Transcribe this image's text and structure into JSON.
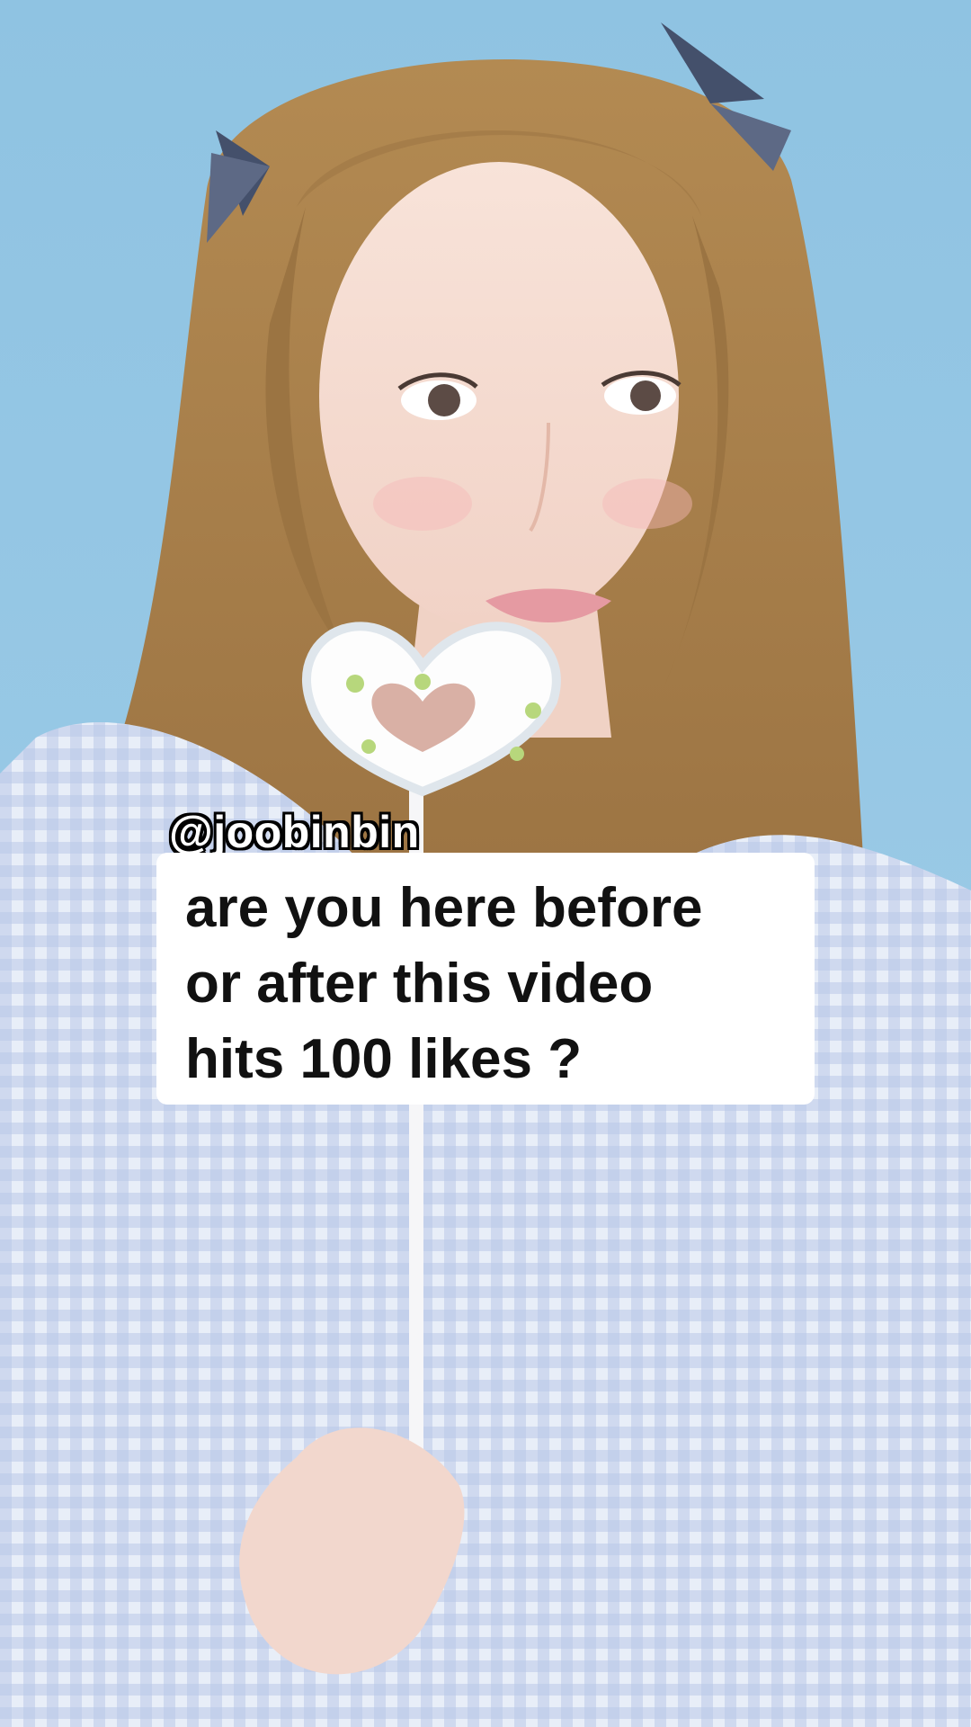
{
  "video": {
    "username": "@joobinbin",
    "caption_lines": [
      "are you here before",
      "or after this video",
      "hits 100 likes ?"
    ]
  },
  "colors": {
    "background": "#8fc3e2",
    "caption_bg": "#ffffff",
    "caption_text": "#111111",
    "username_text": "#ffffff"
  }
}
